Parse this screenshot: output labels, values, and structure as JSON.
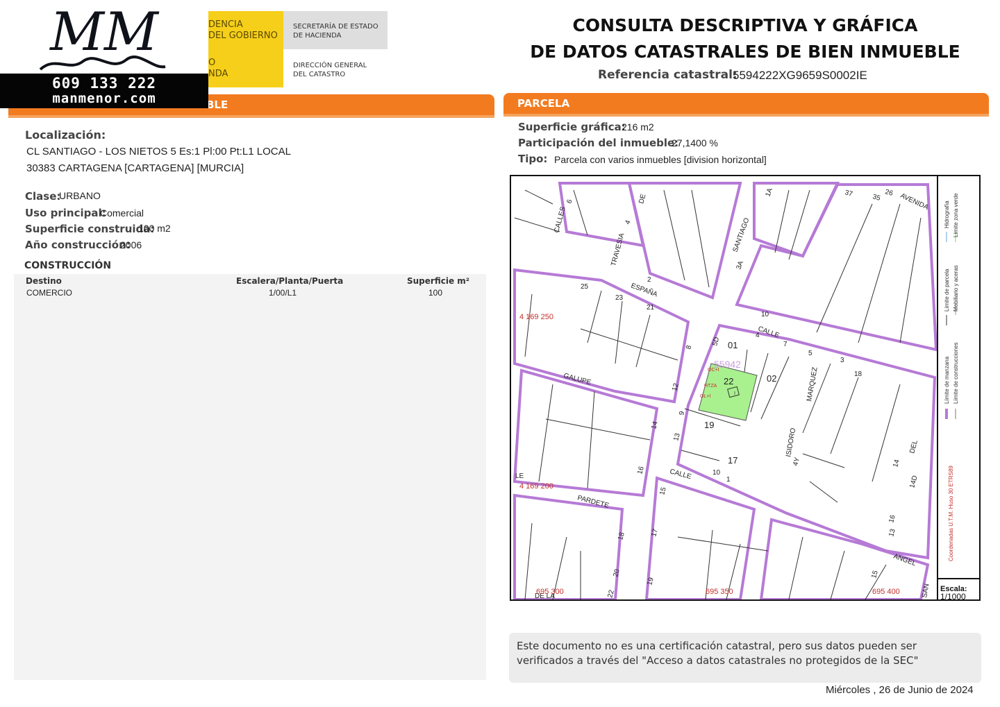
{
  "header": {
    "logo": {
      "monogram": "MM",
      "phone": "609 133 222",
      "website": "manmenor.com"
    },
    "ministry": {
      "partial_lines": [
        "DENCIA",
        "DEL GOBIERNO",
        "O",
        "NDA"
      ],
      "sec_estado": [
        "SECRETARÍA DE ESTADO",
        "DE HACIENDA"
      ],
      "dir_general": [
        "DIRECCIÓN GENERAL",
        "DEL CATASTRO"
      ]
    },
    "title_lines": [
      "CONSULTA DESCRIPTIVA Y GRÁFICA",
      "DE DATOS CATASTRALES DE BIEN INMUEBLE"
    ],
    "referencia_label": "Referencia catastral:",
    "referencia_value": "5594222XG9659S0002IE"
  },
  "left": {
    "section_title_partial": "BLE",
    "localizacion_label": "Localización:",
    "localizacion_line1": "CL SANTIAGO - LOS NIETOS 5 Es:1 Pl:00 Pt:L1 LOCAL",
    "localizacion_line2": "30383 CARTAGENA [CARTAGENA] [MURCIA]",
    "clase_label": "Clase:",
    "clase_value": "URBANO",
    "uso_label": "Uso principal:",
    "uso_value": "Comercial",
    "sup_label": "Superficie construida:",
    "sup_value": "100 m2",
    "anio_label": "Año construcción:",
    "anio_value": "2006",
    "construccion_title": "CONSTRUCCIÓN",
    "table": {
      "headers": [
        "Destino",
        "Escalera/Planta/Puerta",
        "Superficie m²"
      ],
      "rows": [
        [
          "COMERCIO",
          "1/00/L1",
          "100"
        ]
      ]
    }
  },
  "right": {
    "section_title": "PARCELA",
    "sup_grafica_label": "Superficie gráfica:",
    "sup_grafica_value": "216 m2",
    "participacion_label": "Participación del inmueble:",
    "participacion_value": "27,1400 %",
    "tipo_label": "Tipo:",
    "tipo_value": "Parcela con varios inmuebles [division horizontal]"
  },
  "map": {
    "street_labels": [
      "CALLES",
      "TRAVESIA",
      "DE",
      "SANTIAGO",
      "ESPAÑA",
      "CALLE",
      "GALUPE",
      "PARDETE",
      "MARQUEZ",
      "ISIDORO",
      "AVENIDA",
      "ANGEL",
      "DEL",
      "SAN",
      "LE",
      "DE LA"
    ],
    "parcel_numbers": [
      "01",
      "02",
      "22",
      "19",
      "17",
      "55942"
    ],
    "small_labels": [
      "OC+I",
      "HTZA",
      "OL+I",
      "I"
    ],
    "house_numbers": [
      "6",
      "4",
      "2",
      "1A",
      "3A",
      "25",
      "23",
      "21",
      "5",
      "7",
      "10",
      "8",
      "12",
      "14",
      "16",
      "15",
      "17",
      "18",
      "19",
      "20",
      "22",
      "13",
      "9",
      "11",
      "4Y",
      "3",
      "1",
      "18",
      "37",
      "35",
      "26",
      "14",
      "14D",
      "16",
      "13",
      "15",
      "5D"
    ],
    "coordinates": [
      "4 169 250",
      "4 169 200",
      "695 300",
      "695 350",
      "695 400"
    ],
    "coordinate_note": "Coordenadas U.T.M. Huso 30 ETRS89",
    "legend": [
      "Límite de manzana",
      "Límite de parcela",
      "Límite de construcciones",
      "Mobiliario y aceras",
      "Límite zona verde",
      "Hidrografía"
    ],
    "escala_label": "Escala:",
    "escala_value": "1/1000",
    "colors": {
      "manzana": "#b67ad6",
      "parcela_highlight": "#a9f08f",
      "coord": "#c2302b"
    }
  },
  "footer": {
    "notice": "Este documento no es una certificación catastral, pero sus datos pueden ser verificados a través del \"Acceso a datos catastrales no protegidos de la SEC\"",
    "date": "Miércoles , 26 de Junio de 2024"
  }
}
